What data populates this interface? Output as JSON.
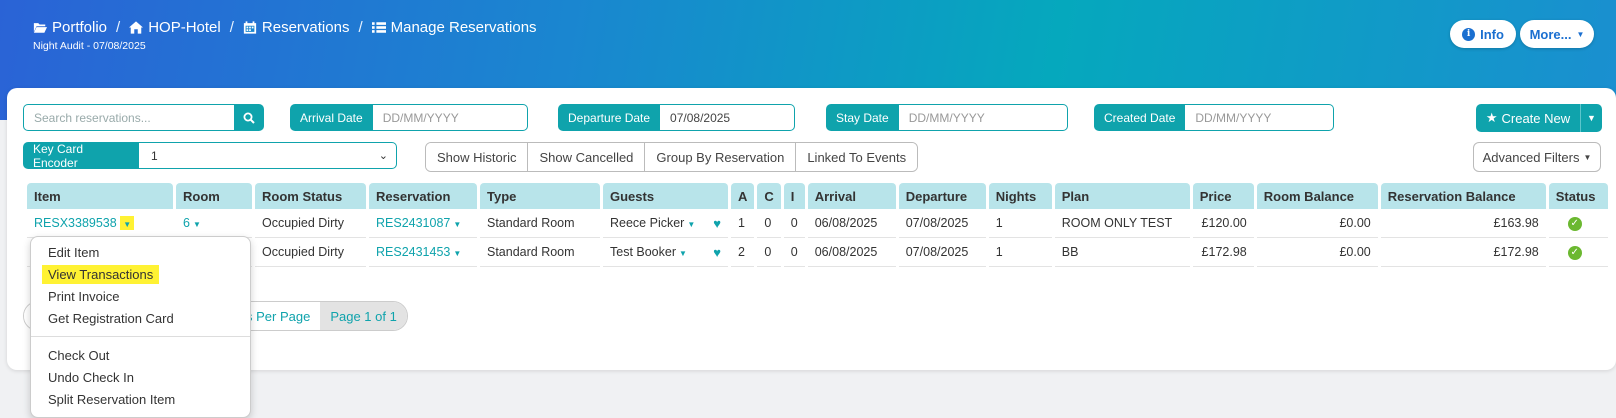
{
  "breadcrumb": [
    "Portfolio",
    "HOP-Hotel",
    "Reservations",
    "Manage Reservations"
  ],
  "subtitle": "Night Audit - 07/08/2025",
  "header_buttons": {
    "info": "Info",
    "more": "More..."
  },
  "search": {
    "placeholder": "Search reservations..."
  },
  "filters": {
    "arrival": {
      "label": "Arrival Date",
      "value": "",
      "placeholder": "DD/MM/YYYY"
    },
    "departure": {
      "label": "Departure Date",
      "value": "07/08/2025",
      "placeholder": "DD/MM/YYYY"
    },
    "stay": {
      "label": "Stay Date",
      "value": "",
      "placeholder": "DD/MM/YYYY"
    },
    "created": {
      "label": "Created Date",
      "value": "",
      "placeholder": "DD/MM/YYYY"
    }
  },
  "create_new": "Create New",
  "key_card": {
    "label": "Key Card Encoder",
    "value": "1"
  },
  "toggle_buttons": [
    "Show Historic",
    "Show Cancelled",
    "Group By Reservation",
    "Linked To Events"
  ],
  "advanced_filters": "Advanced Filters",
  "table": {
    "headers": [
      "Item",
      "Room",
      "Room Status",
      "Reservation",
      "Type",
      "Guests",
      "A",
      "C",
      "I",
      "Arrival",
      "Departure",
      "Nights",
      "Plan",
      "Price",
      "Room Balance",
      "Reservation Balance",
      "Status"
    ],
    "rows": [
      {
        "item": "RESX3389538",
        "room": "6",
        "room_status": "Occupied Dirty",
        "reservation": "RES2431087",
        "type": "Standard Room",
        "guest": "Reece Picker",
        "a": "1",
        "c": "0",
        "i": "0",
        "arrival": "06/08/2025",
        "departure": "07/08/2025",
        "nights": "1",
        "plan": "ROOM ONLY TEST",
        "price": "£120.00",
        "room_balance": "£0.00",
        "res_balance": "£163.98"
      },
      {
        "item": "",
        "room": "",
        "room_status": "Occupied Dirty",
        "reservation": "RES2431453",
        "type": "Standard Room",
        "guest": "Test Booker",
        "a": "2",
        "c": "0",
        "i": "0",
        "arrival": "06/08/2025",
        "departure": "07/08/2025",
        "nights": "1",
        "plan": "BB",
        "price": "£172.98",
        "room_balance": "£0.00",
        "res_balance": "£172.98"
      }
    ]
  },
  "pagination": {
    "per_page_fragment": "s Per Page",
    "page_info": "Page 1 of 1"
  },
  "context_menu": {
    "group1": [
      "Edit Item",
      "View Transactions",
      "Print Invoice",
      "Get Registration Card"
    ],
    "group2": [
      "Check Out",
      "Undo Check In",
      "Split Reservation Item"
    ]
  },
  "colors": {
    "accent": "#0fa3ac",
    "highlight": "#fff233",
    "header_bg": "#b8e4ea",
    "status_ok": "#6bb830"
  }
}
